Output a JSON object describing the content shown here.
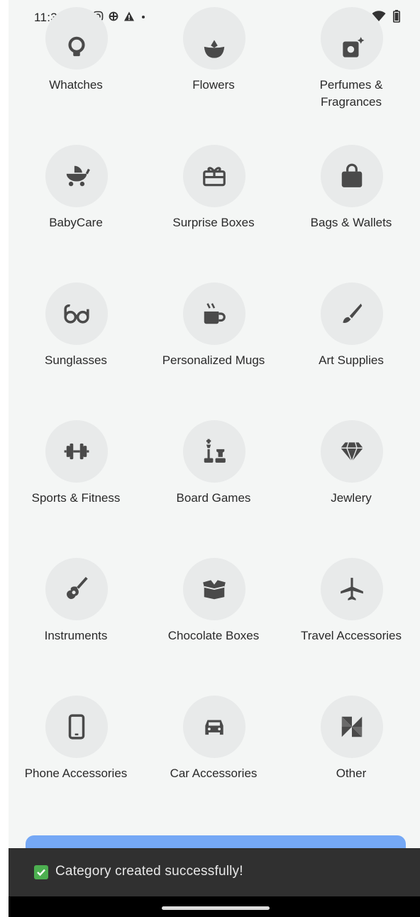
{
  "status_bar": {
    "time": "11:35"
  },
  "categories": [
    {
      "label": "Whatches",
      "icon": "watch-icon"
    },
    {
      "label": "Flowers",
      "icon": "flower-icon"
    },
    {
      "label": "Perfumes &",
      "label2": "Fragrances",
      "icon": "perfume-icon"
    },
    {
      "label": "BabyCare",
      "icon": "baby-stroller-icon"
    },
    {
      "label": "Surprise Boxes",
      "icon": "gift-box-icon"
    },
    {
      "label": "Bags & Wallets",
      "icon": "shopping-bag-icon"
    },
    {
      "label": "Sunglasses",
      "icon": "glasses-icon"
    },
    {
      "label": "Personalized Mugs",
      "icon": "mug-icon"
    },
    {
      "label": "Art Supplies",
      "icon": "paintbrush-icon"
    },
    {
      "label": "Sports & Fitness",
      "icon": "dumbbell-icon"
    },
    {
      "label": "Board Games",
      "icon": "chess-icon"
    },
    {
      "label": "Jewlery",
      "icon": "diamond-icon"
    },
    {
      "label": "Instruments",
      "icon": "guitar-icon"
    },
    {
      "label": "Chocolate Boxes",
      "icon": "open-box-icon"
    },
    {
      "label": "Travel Accessories",
      "icon": "airplane-icon"
    },
    {
      "label": "Phone Accessories",
      "icon": "phone-icon"
    },
    {
      "label": "Car Accessories",
      "icon": "car-icon"
    },
    {
      "label": "Other",
      "icon": "pinwheel-icon"
    }
  ],
  "snackbar": {
    "message": "Category created successfully!",
    "icon": "check-mark-icon"
  },
  "colors": {
    "icon": "#4a4a4a",
    "circle": "#e8eaea",
    "background": "#f4f6f5",
    "button": "#75a8f5",
    "snackbar": "#303030"
  }
}
